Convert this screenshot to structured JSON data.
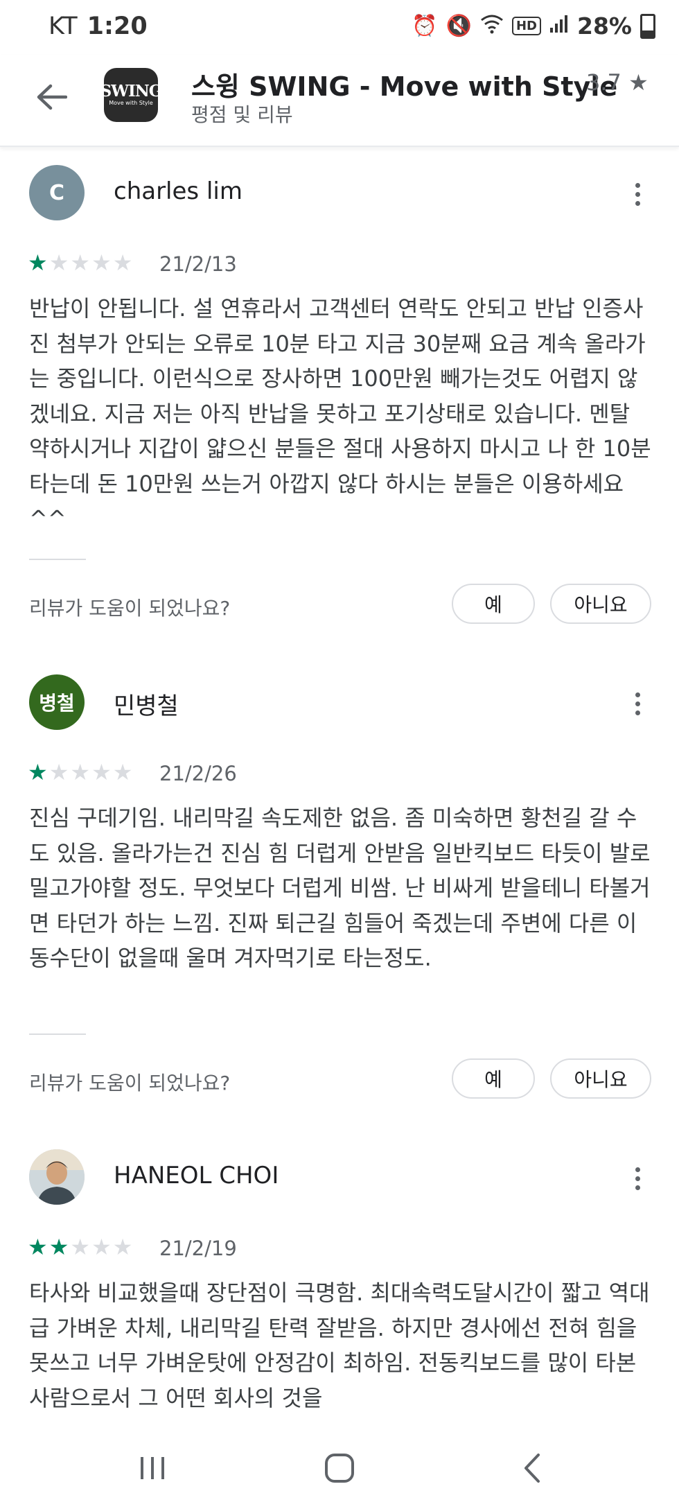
{
  "status_bar": {
    "carrier": "KT",
    "time": "1:20",
    "hd": "HD",
    "battery": "28%",
    "icons": [
      "alarm-icon",
      "mute-icon",
      "wifi-icon",
      "signal-icon",
      "battery-icon"
    ]
  },
  "header": {
    "title": "스윙 SWING - Move with Style",
    "rating": "3.7 ★",
    "subtitle": "평점 및 리뷰",
    "logo_brand": "SWING",
    "logo_tag": "Move with Style"
  },
  "reviews": [
    {
      "avatar_letter": "C",
      "avatar_color": "#78909c",
      "author": "charles lim",
      "rating": 1,
      "date": "21/2/13",
      "text": "반납이 안됩니다. 설 연휴라서 고객센터 연락도 안되고 반납 인증사진 첨부가 안되는 오류로 10분 타고 지금 30분째 요금 계속 올라가는 중입니다. 이런식으로 장사하면 100만원 빼가는것도 어렵지 않겠네요. 지금 저는 아직 반납을 못하고 포기상태로 있습니다. 멘탈 약하시거나 지갑이 얇으신 분들은 절대 사용하지 마시고 나 한 10분 타는데 돈 10만원 쓰는거 아깝지 않다 하시는 분들은 이용하세요 ^^",
      "helpful_q": "리뷰가 도움이 되었나요?",
      "yes": "예",
      "no": "아니요"
    },
    {
      "avatar_letter": "병철",
      "avatar_color": "#33691e",
      "author": "민병철",
      "rating": 1,
      "date": "21/2/26",
      "text": "진심 구데기임. 내리막길 속도제한 없음. 좀 미숙하면 황천길 갈 수도 있음. 올라가는건 진심 힘 더럽게 안받음 일반킥보드 타듯이 발로 밀고가야할 정도. 무엇보다 더럽게 비쌈. 난 비싸게 받을테니 타볼거면 타던가 하는 느낌. 진짜 퇴근길 힘들어 죽겠는데 주변에 다른 이동수단이 없을때 울며 겨자먹기로 타는정도.",
      "helpful_q": "리뷰가 도움이 되었나요?",
      "yes": "예",
      "no": "아니요"
    },
    {
      "avatar_letter": "",
      "avatar_color": "#c8b8a8",
      "author": "HANEOL CHOI",
      "rating": 2,
      "date": "21/2/19",
      "text": "타사와 비교했을때 장단점이 극명함. 최대속력도달시간이 짧고 역대급 가벼운 차체, 내리막길 탄력 잘받음. 하지만 경사에선 전혀 힘을 못쓰고 너무 가벼운탓에 안정감이 최하임. 전동킥보드를 많이 타본 사람으로서 그 어떤 회사의 것을"
    }
  ],
  "nav": [
    "recent-apps-icon",
    "home-icon",
    "back-nav-icon"
  ]
}
